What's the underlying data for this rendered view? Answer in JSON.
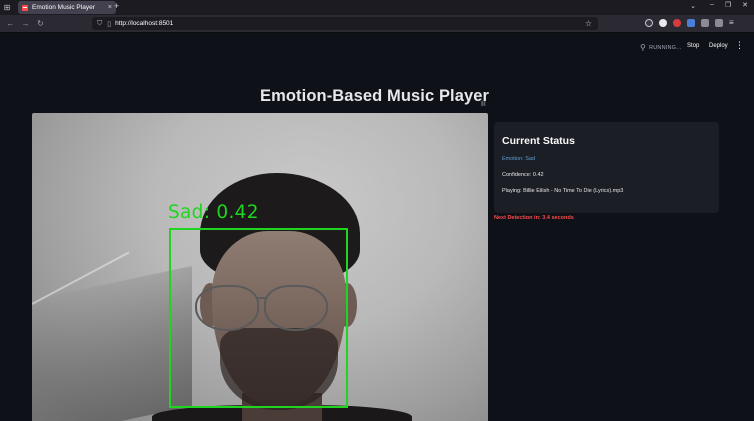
{
  "browser": {
    "tab_title": "Emotion Music Player",
    "tab_close": "×",
    "new_tab": "+",
    "url": "http://localhost:8501",
    "window_controls": [
      "⌄",
      "–",
      "❐",
      "✕"
    ]
  },
  "header": {
    "status": "RUNNING...",
    "stop_label": "Stop",
    "deploy_label": "Deploy",
    "menu": "⋮"
  },
  "main": {
    "title": "Emotion-Based Music Player",
    "webcam": {
      "detection_label": "Sad: 0.42",
      "box_color": "#1fd51f"
    }
  },
  "status": {
    "title": "Current Status",
    "emotion": "Emotion: Sad",
    "confidence": "Confidence: 0.42",
    "playing": "Playing: Billie Eilish - No Time To Die (Lyrics).mp3",
    "next_detection": "Next Detection in: 3.4 seconds"
  },
  "colors": {
    "background": "#0e1117",
    "card": "#1c1e25",
    "emotion_text": "#5a9fd4",
    "warning": "#ff4b4b",
    "accent": "#ff4b4b"
  }
}
